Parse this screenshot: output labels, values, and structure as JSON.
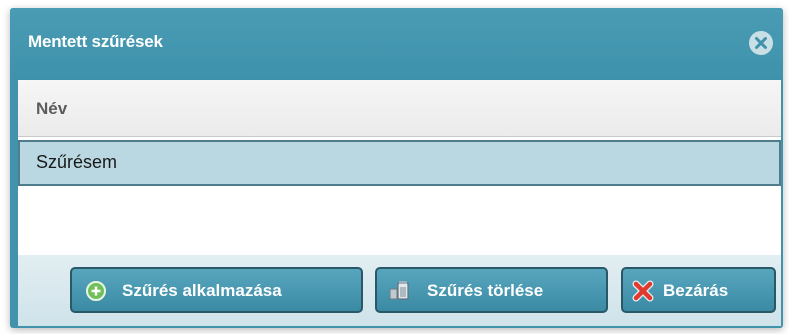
{
  "dialog": {
    "title": "Mentett szűrések",
    "close_icon": "close-circle-icon"
  },
  "list": {
    "column_header": "Név",
    "rows": [
      "Szűrésem"
    ]
  },
  "buttons": {
    "apply": {
      "label": "Szűrés alkalmazása",
      "icon": "add-circle-icon"
    },
    "delete": {
      "label": "Szűrés törlése",
      "icon": "trash-can-icon"
    },
    "close": {
      "label": "Bezárás",
      "icon": "red-x-icon"
    }
  },
  "colors": {
    "titlebar": "#4193ac",
    "selected_row": "#b9d8e2",
    "button": "#4a9ab3",
    "footer": "#d8e8ee"
  }
}
